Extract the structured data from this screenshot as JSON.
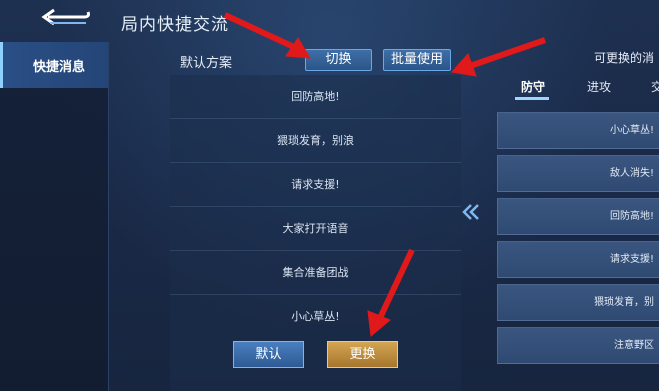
{
  "header": {
    "title": "局内快捷交流"
  },
  "sidebar": {
    "items": [
      {
        "label": "快捷消息"
      }
    ]
  },
  "main": {
    "scheme_label": "默认方案",
    "switch_button": "切换",
    "batch_button": "批量使用",
    "messages": [
      "回防高地!",
      "猥琐发育，别浪",
      "请求支援!",
      "大家打开语音",
      "集合准备团战",
      "小心草丛!"
    ],
    "default_button": "默认",
    "replace_button": "更换"
  },
  "right_panel": {
    "title": "可更换的消",
    "tabs": [
      {
        "label": "防守"
      },
      {
        "label": "进攻"
      },
      {
        "label": "交"
      }
    ],
    "items": [
      "小心草丛!",
      "敌人消失!",
      "回防高地!",
      "请求支援!",
      "猥琐发育，别",
      "注意野区"
    ]
  },
  "colors": {
    "accent": "#6aa8e8",
    "gold_button": "#c89645",
    "annotation_arrow": "#e0191b"
  }
}
